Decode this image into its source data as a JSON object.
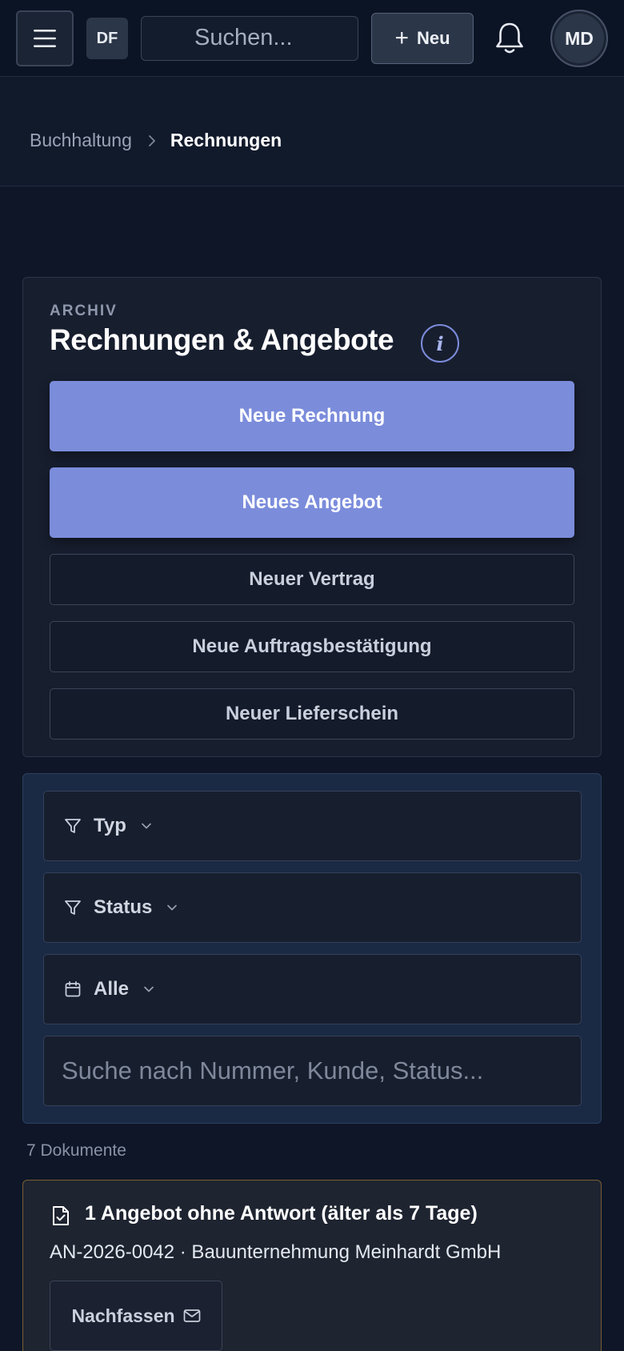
{
  "topbar": {
    "org_initials": "DF",
    "search_placeholder": "Suchen...",
    "new_button_label": "Neu",
    "user_initials": "MD"
  },
  "breadcrumb": {
    "parent": "Buchhaltung",
    "current": "Rechnungen"
  },
  "archive": {
    "eyebrow": "ARCHIV",
    "title": "Rechnungen & Angebote",
    "info_icon": "i",
    "primary_actions": [
      "Neue Rechnung",
      "Neues Angebot"
    ],
    "secondary_actions": [
      "Neuer Vertrag",
      "Neue Auftragsbestätigung",
      "Neuer Lieferschein"
    ]
  },
  "filters": {
    "type_label": "Typ",
    "status_label": "Status",
    "date_label": "Alle",
    "search_placeholder": "Suche nach Nummer, Kunde, Status..."
  },
  "document_count": "7 Dokumente",
  "alert": {
    "title": "1 Angebot ohne Antwort (älter als 7 Tage)",
    "detail": "AN-2026-0042 · Bauunternehmung Meinhardt GmbH",
    "followup_label": "Nachfassen"
  },
  "colors": {
    "primary_button": "#7b8cdb",
    "background": "#0e1628",
    "alert_border": "#7a5e34"
  }
}
